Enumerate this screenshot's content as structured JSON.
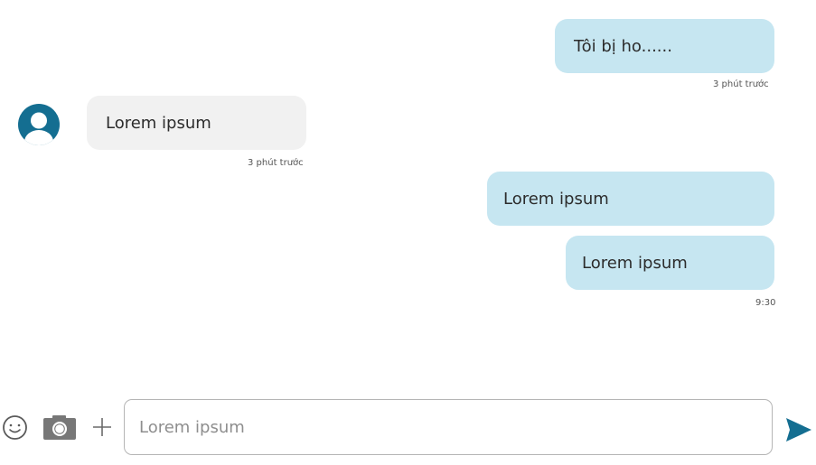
{
  "messages": [
    {
      "side": "out",
      "text": "Tôi bị ho......"
    },
    {
      "side": "in",
      "text": "Lorem ipsum"
    },
    {
      "side": "out",
      "text": "Lorem ipsum"
    },
    {
      "side": "out",
      "text": "Lorem ipsum"
    }
  ],
  "timestamps": {
    "first_out": "3 phút trước",
    "first_in": "3 phút trước",
    "last_out": "9:30"
  },
  "composer": {
    "placeholder": "Lorem ipsum",
    "icons": [
      "emoji-icon",
      "camera-icon",
      "plus-icon",
      "send-icon"
    ]
  },
  "colors": {
    "outgoing_bubble": "#c6e6f1",
    "incoming_bubble": "#f1f1f1",
    "accent": "#146e91"
  }
}
